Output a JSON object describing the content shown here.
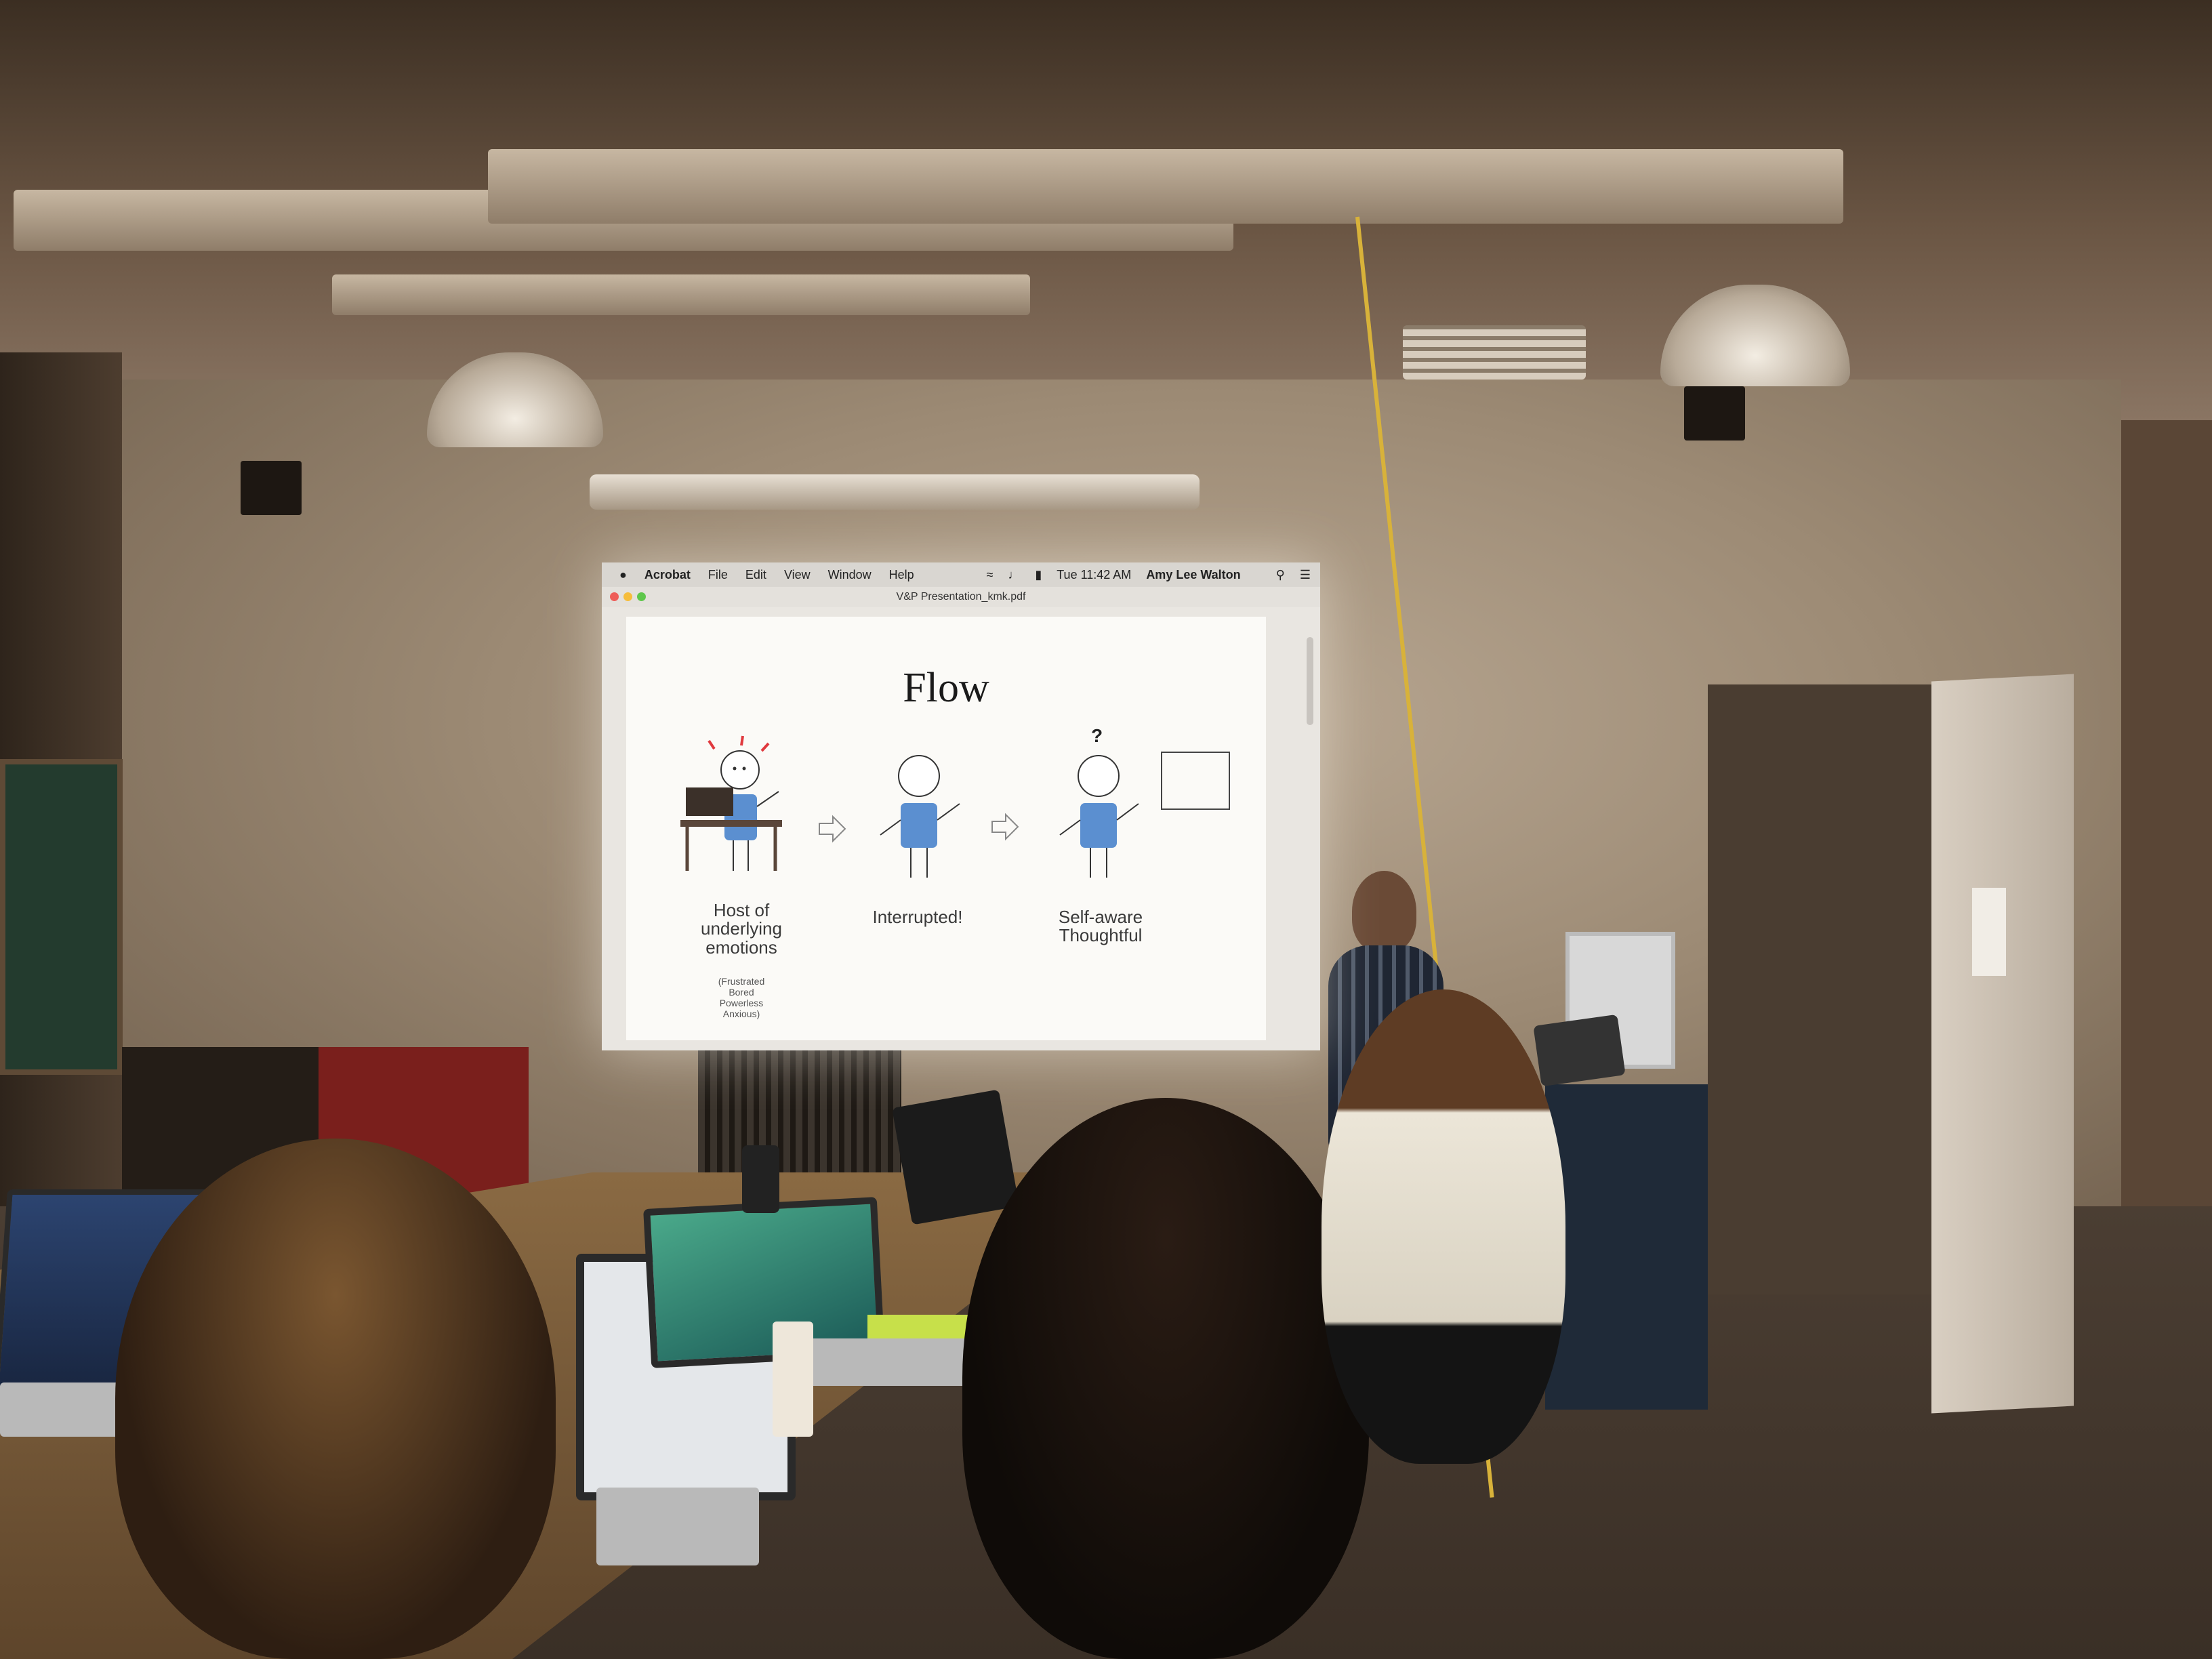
{
  "menubar": {
    "app_name": "Acrobat",
    "menus": [
      "File",
      "Edit",
      "View",
      "Window",
      "Help"
    ],
    "clock": "Tue 11:42 AM",
    "user": "Amy Lee Walton"
  },
  "window": {
    "title": "V&P Presentation_kmk.pdf"
  },
  "slide": {
    "title": "Flow",
    "stages": [
      {
        "caption": "Host of underlying emotions",
        "subcaption": [
          "(Frustrated",
          "Bored",
          "Powerless",
          "Anxious)"
        ]
      },
      {
        "caption": "Interrupted!"
      },
      {
        "caption_line1": "Self-aware",
        "caption_line2": "Thoughtful",
        "mark": "?"
      }
    ]
  },
  "colors": {
    "figure_body": "#5b8fd0",
    "alert_marks": "#e0393e",
    "slide_background": "#fbfaf7"
  }
}
